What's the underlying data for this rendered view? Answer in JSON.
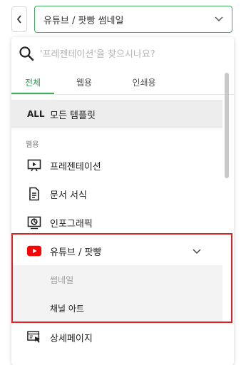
{
  "header": {
    "select_value": "유튜브 / 팟빵 썸네일"
  },
  "search": {
    "placeholder": "'프레젠테이션'을 찾으시나요?"
  },
  "tabs": [
    {
      "label": "전체"
    },
    {
      "label": "웹용"
    },
    {
      "label": "인쇄용"
    }
  ],
  "all_item": {
    "badge": "ALL",
    "label": "모든 템플릿"
  },
  "section": {
    "label": "웹용"
  },
  "items": [
    {
      "label": "프레젠테이션",
      "icon": "presentation-icon"
    },
    {
      "label": "문서 서식",
      "icon": "document-icon"
    },
    {
      "label": "인포그래픽",
      "icon": "infographic-icon"
    },
    {
      "label": "유튜브 / 팟빵",
      "icon": "youtube-icon"
    },
    {
      "label": "상세페이지",
      "icon": "detail-page-icon"
    }
  ],
  "sub_items": [
    {
      "label": "썸네일"
    },
    {
      "label": "채널 아트"
    }
  ],
  "colors": {
    "accent": "#3fae61",
    "highlight_border": "#e02020",
    "youtube_red": "#ff0000"
  }
}
